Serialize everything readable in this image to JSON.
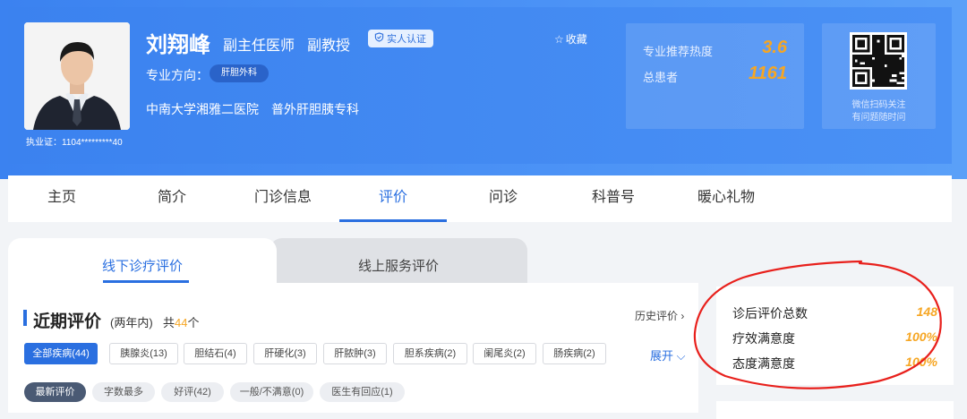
{
  "doctor": {
    "name": "刘翔峰",
    "title": "副主任医师",
    "academic_title": "副教授",
    "verified_label": "实人认证",
    "favorite_label": "收藏",
    "license": "执业证：1104*********40",
    "specialty_label": "专业方向：",
    "specialty_tag": "肝胆外科",
    "hospital": "中南大学湘雅二医院",
    "department": "普外肝胆胰专科"
  },
  "stats": {
    "recommend_label": "专业推荐热度",
    "recommend_value": "3.6",
    "patients_label": "总患者",
    "patients_value": "1161"
  },
  "qr": {
    "line1": "微信扫码关注",
    "line2": "有问题随时问"
  },
  "nav": {
    "tabs": [
      "主页",
      "简介",
      "门诊信息",
      "评价",
      "问诊",
      "科普号",
      "暖心礼物"
    ],
    "active": "评价"
  },
  "subtabs": {
    "offline": "线下诊疗评价",
    "online": "线上服务评价"
  },
  "reviews": {
    "title": "近期评价",
    "subtitle": "(两年内)",
    "total_prefix": "共",
    "total_count": "44",
    "total_suffix": "个",
    "history_label": "历史评价",
    "expand_label": "展开",
    "disease_filters": [
      "全部疾病(44)",
      "胰腺炎(13)",
      "胆结石(4)",
      "肝硬化(3)",
      "肝脓肿(3)",
      "胆系疾病(2)",
      "阑尾炎(2)",
      "肠疾病(2)"
    ],
    "sort_filters": [
      "最新评价",
      "字数最多",
      "好评(42)",
      "一般/不满意(0)",
      "医生有回应(1)"
    ]
  },
  "satisfaction": {
    "total_label": "诊后评价总数",
    "total_value": "148",
    "effect_label": "疗效满意度",
    "effect_value": "100%",
    "attitude_label": "态度满意度",
    "attitude_value": "100%"
  },
  "colors": {
    "brand": "#2a6fe0",
    "accent": "#f6a623",
    "annotation": "#e8201c"
  },
  "icons": {
    "verify": "shield-check-icon",
    "favorite": "star-outline-icon",
    "history": "chevron-right-icon",
    "expand": "chevron-down-icon"
  }
}
